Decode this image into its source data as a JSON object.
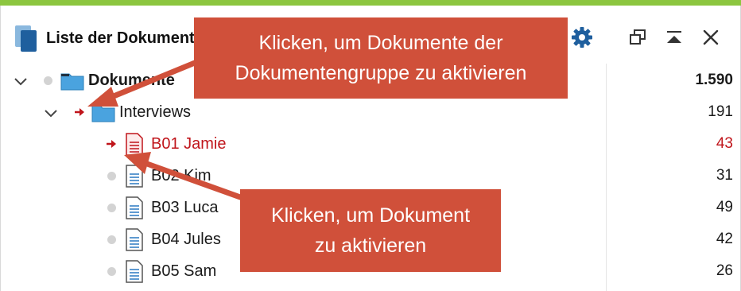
{
  "colors": {
    "accent_bar": "#8cc63f",
    "folder_blue": "#4aa3df",
    "activated_red": "#c0151b",
    "callout_bg": "#d0503a",
    "gear_blue": "#1f5f9e"
  },
  "header": {
    "title": "Liste der Dokumente",
    "icons": [
      "document-list-icon",
      "gear-icon",
      "undock-window-icon",
      "collapse-up-icon",
      "close-icon"
    ]
  },
  "tree": {
    "root": {
      "label": "Dokumente",
      "count": "1.590",
      "icon": "folder-icon"
    },
    "group": {
      "label": "Interviews",
      "count": "191",
      "icon": "folder-icon"
    },
    "documents": [
      {
        "label": "B01 Jamie",
        "count": "43",
        "activated": true
      },
      {
        "label": "B02 Kim",
        "count": "31",
        "activated": false
      },
      {
        "label": "B03 Luca",
        "count": "49",
        "activated": false
      },
      {
        "label": "B04 Jules",
        "count": "42",
        "activated": false
      },
      {
        "label": "B05 Sam",
        "count": "26",
        "activated": false
      }
    ]
  },
  "callouts": {
    "group_activation": {
      "line1": "Klicken, um Dokumente der",
      "line2": "Dokumentengruppe zu aktivieren"
    },
    "document_activation": {
      "line1": "Klicken, um Dokument",
      "line2": "zu aktivieren"
    }
  }
}
